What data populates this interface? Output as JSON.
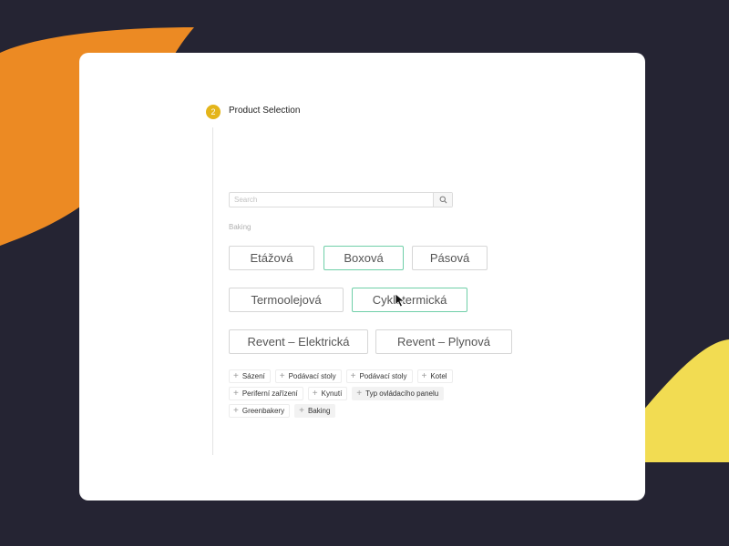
{
  "step": {
    "number": "2",
    "title": "Product Selection"
  },
  "search": {
    "placeholder": "Search",
    "value": "",
    "icon": "search-icon"
  },
  "section": {
    "label": "Baking"
  },
  "options": [
    {
      "label": "Etážová",
      "selected": false
    },
    {
      "label": "Boxová",
      "selected": true
    },
    {
      "label": "Pásová",
      "selected": false
    },
    {
      "label": "Termoolejová",
      "selected": false
    },
    {
      "label": "Cyklotermická",
      "selected": true
    },
    {
      "label": "Revent – Elektrická",
      "selected": false
    },
    {
      "label": "Revent – Plynová",
      "selected": false
    }
  ],
  "tags": [
    {
      "label": "Sázení",
      "filled": false
    },
    {
      "label": "Podávací stoly",
      "filled": false
    },
    {
      "label": "Podávací stoly",
      "filled": false
    },
    {
      "label": "Kotel",
      "filled": false
    },
    {
      "label": "Periferní zařízení",
      "filled": false
    },
    {
      "label": "Kynutí",
      "filled": false
    },
    {
      "label": "Typ ovládacího panelu",
      "filled": true
    },
    {
      "label": "Greenbakery",
      "filled": false
    },
    {
      "label": "Baking",
      "filled": true
    }
  ],
  "colors": {
    "background": "#252433",
    "accent_orange": "#ec8a23",
    "accent_yellow": "#f2dc52",
    "step_badge": "#e4b51a",
    "selected_border": "#6fcfa8"
  }
}
